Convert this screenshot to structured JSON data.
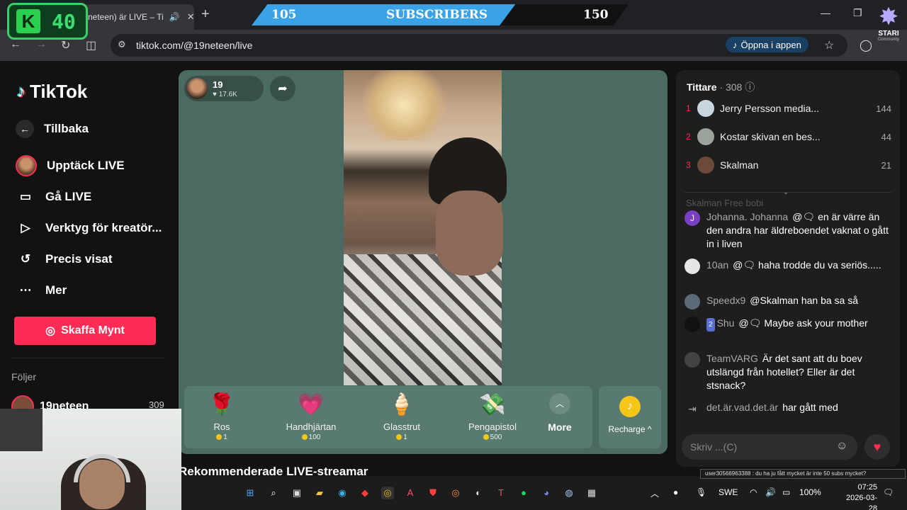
{
  "browser": {
    "tab_title": "neteen) är LIVE – Ti",
    "url": "tiktok.com/@19neteen/live",
    "open_in_app": "Öppna i appen"
  },
  "overlay": {
    "k_counter": "40",
    "subs_current": "105",
    "subs_label": "SUBSCRIBERS",
    "subs_goal": "150",
    "subs_progress": 0.7,
    "star_logo_label": "STARI",
    "star_logo_sub": "Community"
  },
  "sidebar": {
    "logo": "TikTok",
    "back": "Tillbaka",
    "items": [
      {
        "label": "Upptäck LIVE",
        "icon": "live-avatar"
      },
      {
        "label": "Gå LIVE",
        "icon": "camera-icon"
      },
      {
        "label": "Verktyg för kreatör...",
        "icon": "creator-tools-icon"
      },
      {
        "label": "Precis visat",
        "icon": "history-icon"
      },
      {
        "label": "Mer",
        "icon": "more-icon"
      }
    ],
    "get_coins": "Skaffa Mynt",
    "following_header": "Följer",
    "following": [
      {
        "name": "19neteen",
        "count": "309"
      }
    ]
  },
  "player": {
    "host_name": "19",
    "host_likes": "17.6K",
    "gifts": [
      {
        "name": "Ros",
        "price": "1",
        "icon": "🌹"
      },
      {
        "name": "Handhjärtan",
        "price": "100",
        "icon": "💗"
      },
      {
        "name": "Glasstrut",
        "price": "1",
        "icon": "🍦"
      },
      {
        "name": "Pengapistol",
        "price": "500",
        "icon": "💸"
      }
    ],
    "more": "More",
    "recharge": "Recharge"
  },
  "recommended_title": "Rekommenderade LIVE-streamar",
  "chat": {
    "viewers_title": "Tittare",
    "viewers_count": "· 308",
    "top_viewers": [
      {
        "rank": "1",
        "name": "Jerry Persson media...",
        "count": "144",
        "color": "#c8d6df"
      },
      {
        "rank": "2",
        "name": "Kostar skivan en bes...",
        "count": "44",
        "color": "#9aa39c"
      },
      {
        "rank": "3",
        "name": "Skalman",
        "count": "21",
        "color": "#6b4a3a"
      }
    ],
    "faded_line": "Skalman      Free bobi",
    "messages": [
      {
        "name": "Johanna. Johanna",
        "badge": "",
        "text": "@🗨 en är värre än den andra har äldreboendet vaknat o gått in i liven",
        "avatar": "J",
        "color": "#7b3fc4"
      },
      {
        "name": "10an",
        "badge": "",
        "text": "@🗨 haha trodde du va seriös.....",
        "avatar": "",
        "color": "#e6e6e6"
      },
      {
        "name": "Speedx9",
        "badge": "",
        "text": "@Skalman han ba sa så",
        "avatar": "",
        "color": "#5c6b78"
      },
      {
        "name": "Shu",
        "badge": "2",
        "text": "@🗨 Maybe ask your mother",
        "avatar": "",
        "color": "#111111"
      },
      {
        "name": "TeamVARG",
        "badge": "",
        "text": "Är det sant att du boev utslängd från hotellet? Eller är det stsnack?",
        "avatar": "",
        "color": "#444444"
      },
      {
        "name": "det.är.vad.det.är",
        "badge": "",
        "text": "har gått med",
        "avatar": "",
        "color": "#1e1e1e"
      }
    ],
    "input_placeholder": "Skriv ...(C)"
  },
  "tooltip": "user30566963388 : du ha ju fått mycket är inte 50 subs mycket?",
  "taskbar": {
    "lang": "SWE",
    "battery": "100%",
    "time": "07:25",
    "date": "2026-03-28"
  }
}
